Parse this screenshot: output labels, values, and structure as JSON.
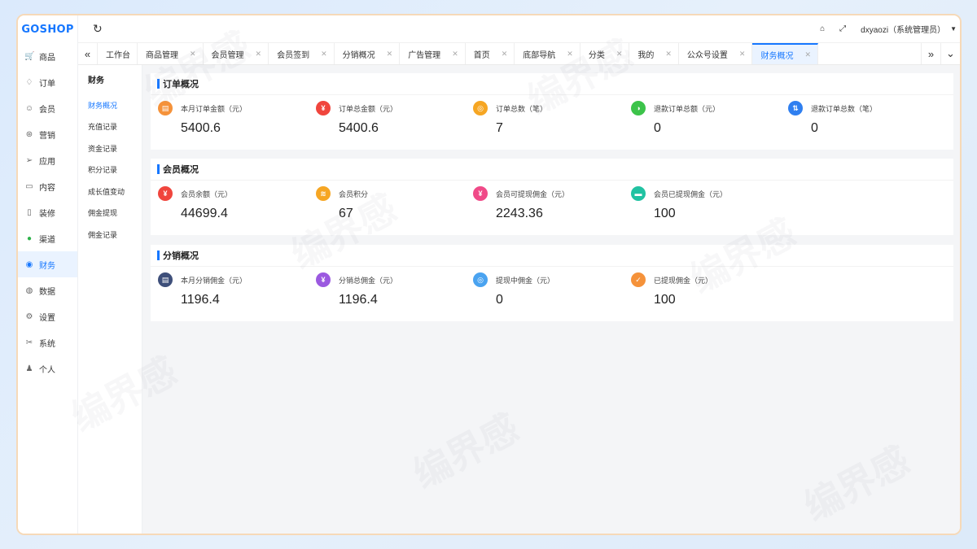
{
  "logo": "GOSHOP",
  "header": {
    "user_label": "dxyaozi（系统管理员）"
  },
  "sidebar": {
    "items": [
      {
        "label": "商品",
        "icon": "cart-icon",
        "glyph": "🛒"
      },
      {
        "label": "订单",
        "icon": "bell-icon",
        "glyph": "♢"
      },
      {
        "label": "会员",
        "icon": "user-icon",
        "glyph": "☺"
      },
      {
        "label": "营销",
        "icon": "gift-icon",
        "glyph": "⊛"
      },
      {
        "label": "应用",
        "icon": "send-icon",
        "glyph": "➢"
      },
      {
        "label": "内容",
        "icon": "book-icon",
        "glyph": "▭"
      },
      {
        "label": "装修",
        "icon": "phone-icon",
        "glyph": "▯"
      },
      {
        "label": "渠道",
        "icon": "wechat-icon",
        "glyph": "●"
      },
      {
        "label": "财务",
        "icon": "finance-icon",
        "glyph": "◉"
      },
      {
        "label": "数据",
        "icon": "globe-icon",
        "glyph": "◍"
      },
      {
        "label": "设置",
        "icon": "gear-icon",
        "glyph": "⚙"
      },
      {
        "label": "系统",
        "icon": "tools-icon",
        "glyph": "✂"
      },
      {
        "label": "个人",
        "icon": "person-icon",
        "glyph": "♟"
      }
    ]
  },
  "tabs": [
    {
      "label": "工作台",
      "closable": false
    },
    {
      "label": "商品管理",
      "closable": true
    },
    {
      "label": "会员管理",
      "closable": true
    },
    {
      "label": "会员签到",
      "closable": true
    },
    {
      "label": "分销概况",
      "closable": true
    },
    {
      "label": "广告管理",
      "closable": true
    },
    {
      "label": "首页",
      "closable": true
    },
    {
      "label": "底部导航",
      "closable": true
    },
    {
      "label": "分类",
      "closable": true
    },
    {
      "label": "我的",
      "closable": true
    },
    {
      "label": "公众号设置",
      "closable": true
    },
    {
      "label": "财务概况",
      "closable": true
    }
  ],
  "submenu": {
    "title": "财务",
    "items": [
      "财务概况",
      "充值记录",
      "资金记录",
      "积分记录",
      "成长值变动",
      "佣金提现",
      "佣金记录"
    ]
  },
  "sections": [
    {
      "title": "订单概况",
      "stats": [
        {
          "label": "本月订单金额（元）",
          "value": "5400.6",
          "color": "#f5923a",
          "glyph": "▤"
        },
        {
          "label": "订单总金额（元）",
          "value": "5400.6",
          "color": "#f0453d",
          "glyph": "¥"
        },
        {
          "label": "订单总数（笔）",
          "value": "7",
          "color": "#f6a623",
          "glyph": "◎"
        },
        {
          "label": "退款订单总额（元）",
          "value": "0",
          "color": "#3cc34a",
          "glyph": "◑"
        },
        {
          "label": "退款订单总数（笔）",
          "value": "0",
          "color": "#2f7ff0",
          "glyph": "⇅"
        }
      ]
    },
    {
      "title": "会员概况",
      "stats": [
        {
          "label": "会员余额（元）",
          "value": "44699.4",
          "color": "#f0453d",
          "glyph": "¥"
        },
        {
          "label": "会员积分",
          "value": "67",
          "color": "#f6a623",
          "glyph": "≋"
        },
        {
          "label": "会员可提现佣金（元）",
          "value": "2243.36",
          "color": "#f04a88",
          "glyph": "¥"
        },
        {
          "label": "会员已提现佣金（元）",
          "value": "100",
          "color": "#21c2a2",
          "glyph": "▬"
        }
      ]
    },
    {
      "title": "分销概况",
      "stats": [
        {
          "label": "本月分销佣金（元）",
          "value": "1196.4",
          "color": "#3e4f7a",
          "glyph": "▤"
        },
        {
          "label": "分销总佣金（元）",
          "value": "1196.4",
          "color": "#9b59e0",
          "glyph": "¥"
        },
        {
          "label": "提现中佣金（元）",
          "value": "0",
          "color": "#4aa3f0",
          "glyph": "◎"
        },
        {
          "label": "已提现佣金（元）",
          "value": "100",
          "color": "#f5923a",
          "glyph": "✓"
        }
      ]
    }
  ],
  "watermark": "编界感"
}
